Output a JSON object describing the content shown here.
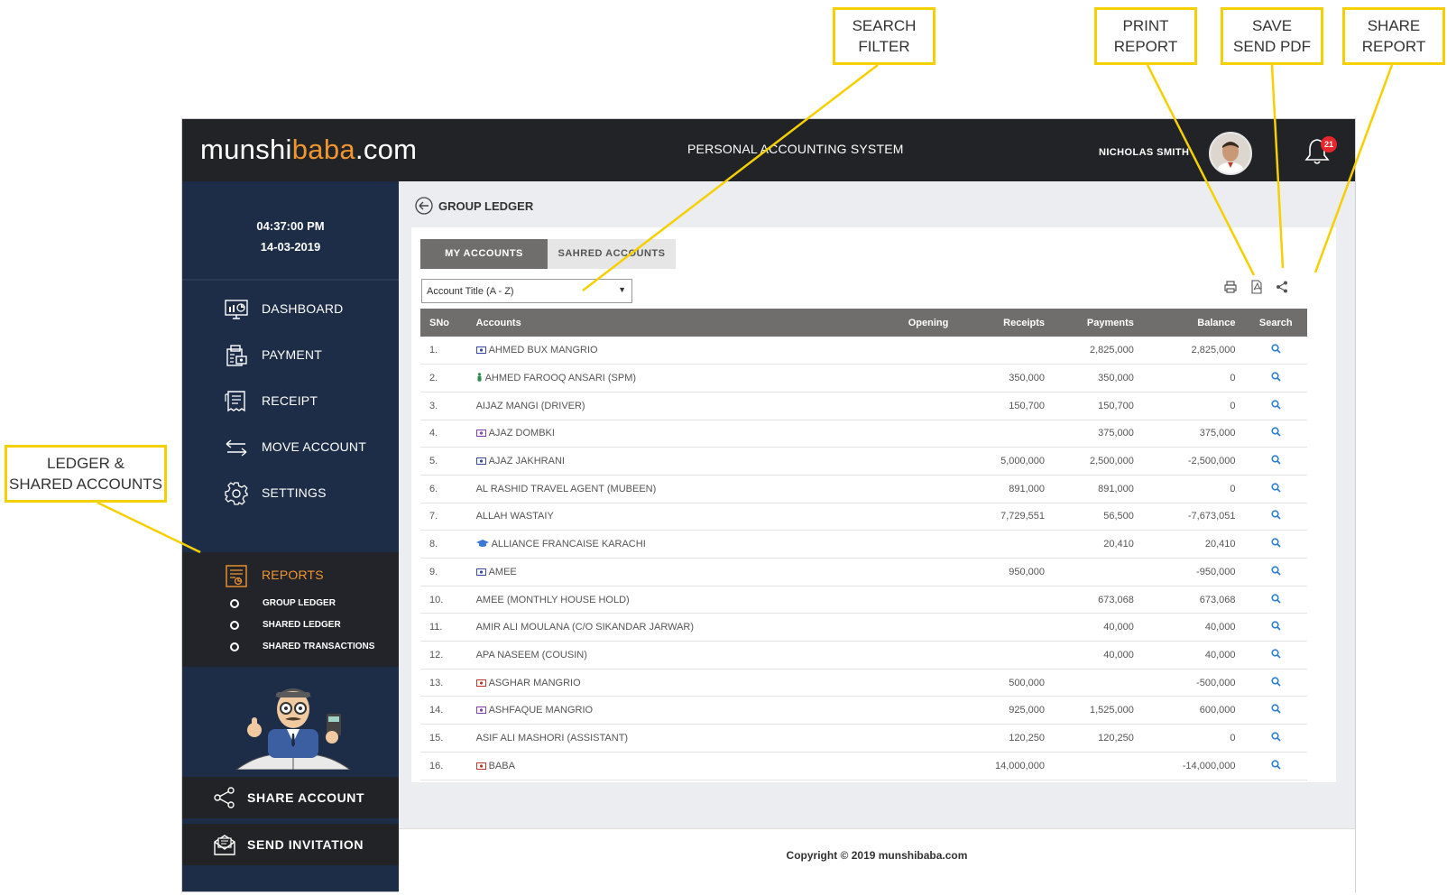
{
  "callouts": {
    "search_filter": "SEARCH\nFILTER",
    "print_report": "PRINT\nREPORT",
    "save_send_pdf": "SAVE\nSEND PDF",
    "share_report": "SHARE\nREPORT",
    "ledger_shared": "LEDGER &\nSHARED ACCOUNTS"
  },
  "header": {
    "logo_prefix": "munshi",
    "logo_accent": "baba",
    "logo_suffix": ".com",
    "app_title": "PERSONAL ACCOUNTING SYSTEM",
    "user_name": "NICHOLAS SMITH",
    "notification_count": "21"
  },
  "sidebar": {
    "time": "04:37:00 PM",
    "date": "14-03-2019",
    "items": [
      {
        "label": "DASHBOARD",
        "icon": "dashboard-icon"
      },
      {
        "label": "PAYMENT",
        "icon": "payment-icon"
      },
      {
        "label": "RECEIPT",
        "icon": "receipt-icon"
      },
      {
        "label": "MOVE ACCOUNT",
        "icon": "move-arrows-icon"
      },
      {
        "label": "SETTINGS",
        "icon": "gear-icon"
      },
      {
        "label": "REPORTS",
        "icon": "reports-icon"
      }
    ],
    "sub_items": [
      "GROUP LEDGER",
      "SHARED LEDGER",
      "SHARED TRANSACTIONS"
    ],
    "share_account": "SHARE ACCOUNT",
    "send_invitation": "SEND INVITATION"
  },
  "main": {
    "title": "GROUP LEDGER",
    "tabs": [
      "MY ACCOUNTS",
      "SAHRED ACCOUNTS"
    ],
    "sort_select": "Account Title (A - Z)",
    "columns": [
      "SNo",
      "Accounts",
      "Opening",
      "Receipts",
      "Payments",
      "Balance",
      "Search"
    ],
    "rows": [
      {
        "sno": "1.",
        "icon": "cash",
        "account": "AHMED BUX MANGRIO",
        "opening": "",
        "receipts": "",
        "payments": "2,825,000",
        "balance": "2,825,000"
      },
      {
        "sno": "2.",
        "icon": "person",
        "account": "AHMED FAROOQ ANSARI (SPM)",
        "opening": "",
        "receipts": "350,000",
        "payments": "350,000",
        "balance": "0"
      },
      {
        "sno": "3.",
        "icon": "",
        "account": "AIJAZ MANGI (DRIVER)",
        "opening": "",
        "receipts": "150,700",
        "payments": "150,700",
        "balance": "0"
      },
      {
        "sno": "4.",
        "icon": "cash-purple",
        "account": "AJAZ DOMBKI",
        "opening": "",
        "receipts": "",
        "payments": "375,000",
        "balance": "375,000"
      },
      {
        "sno": "5.",
        "icon": "cash",
        "account": "AJAZ JAKHRANI",
        "opening": "",
        "receipts": "5,000,000",
        "payments": "2,500,000",
        "balance": "-2,500,000"
      },
      {
        "sno": "6.",
        "icon": "",
        "account": "AL RASHID TRAVEL AGENT (MUBEEN)",
        "opening": "",
        "receipts": "891,000",
        "payments": "891,000",
        "balance": "0"
      },
      {
        "sno": "7.",
        "icon": "",
        "account": "ALLAH WASTAIY",
        "opening": "",
        "receipts": "7,729,551",
        "payments": "56,500",
        "balance": "-7,673,051"
      },
      {
        "sno": "8.",
        "icon": "graduation",
        "account": "ALLIANCE FRANCAISE KARACHI",
        "opening": "",
        "receipts": "",
        "payments": "20,410",
        "balance": "20,410"
      },
      {
        "sno": "9.",
        "icon": "cash",
        "account": "AMEE",
        "opening": "",
        "receipts": "950,000",
        "payments": "",
        "balance": "-950,000"
      },
      {
        "sno": "10.",
        "icon": "",
        "account": "AMEE (MONTHLY HOUSE HOLD)",
        "opening": "",
        "receipts": "",
        "payments": "673,068",
        "balance": "673,068"
      },
      {
        "sno": "11.",
        "icon": "",
        "account": "AMIR ALI MOULANA (C/O SIKANDAR JARWAR)",
        "opening": "",
        "receipts": "",
        "payments": "40,000",
        "balance": "40,000"
      },
      {
        "sno": "12.",
        "icon": "",
        "account": "APA NASEEM (COUSIN)",
        "opening": "",
        "receipts": "",
        "payments": "40,000",
        "balance": "40,000"
      },
      {
        "sno": "13.",
        "icon": "cash-red",
        "account": "ASGHAR MANGRIO",
        "opening": "",
        "receipts": "500,000",
        "payments": "",
        "balance": "-500,000"
      },
      {
        "sno": "14.",
        "icon": "cash-purple",
        "account": "ASHFAQUE MANGRIO",
        "opening": "",
        "receipts": "925,000",
        "payments": "1,525,000",
        "balance": "600,000"
      },
      {
        "sno": "15.",
        "icon": "",
        "account": "ASIF ALI MASHORI (ASSISTANT)",
        "opening": "",
        "receipts": "120,250",
        "payments": "120,250",
        "balance": "0"
      },
      {
        "sno": "16.",
        "icon": "cash-red",
        "account": "BABA",
        "opening": "",
        "receipts": "14,000,000",
        "payments": "",
        "balance": "-14,000,000"
      }
    ]
  },
  "footer": {
    "copyright": "Copyright © 2019 munshibaba.com"
  },
  "colors": {
    "topbar": "#212327",
    "sidebar": "#1d2d48",
    "accent": "#f0962e",
    "callout_border": "#f5d000",
    "search_icon": "#2f7fd6",
    "badge": "#e8262b"
  }
}
